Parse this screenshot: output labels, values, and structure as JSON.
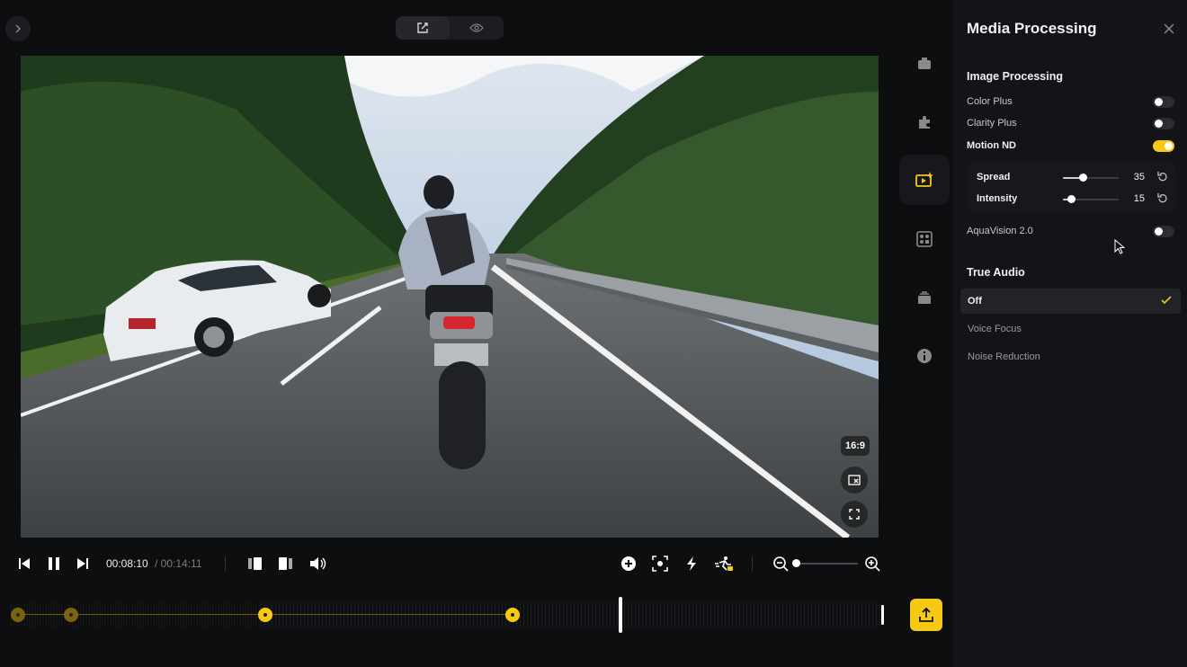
{
  "panel": {
    "title": "Media Processing",
    "image_processing": {
      "title": "Image Processing",
      "items": [
        {
          "label": "Color Plus",
          "enabled": false
        },
        {
          "label": "Clarity Plus",
          "enabled": false
        },
        {
          "label": "Motion ND",
          "enabled": true
        },
        {
          "label": "AquaVision 2.0",
          "enabled": false
        }
      ],
      "motion_nd": {
        "spread": {
          "label": "Spread",
          "value": "35",
          "percent": 35
        },
        "intensity": {
          "label": "Intensity",
          "value": "15",
          "percent": 15
        }
      }
    },
    "true_audio": {
      "title": "True Audio",
      "options": [
        "Off",
        "Voice Focus",
        "Noise Reduction"
      ],
      "selected": "Off"
    }
  },
  "player": {
    "aspect_ratio": "16:9",
    "current_time": "00:08:10",
    "total_time": "/ 00:14:11"
  },
  "colors": {
    "accent": "#f6c914",
    "panel_bg": "#131417",
    "app_bg": "#0d0e10"
  },
  "icons": {
    "collapse": "chevron-right-icon",
    "edit": "edit-icon",
    "preview": "eye-icon",
    "toolbar": [
      "camera-icon",
      "plugin-icon",
      "media-processing-icon",
      "grid-icon",
      "layers-icon",
      "info-icon"
    ]
  }
}
